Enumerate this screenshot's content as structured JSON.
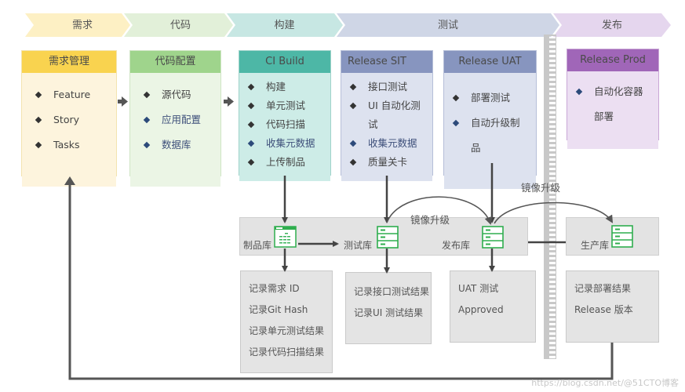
{
  "stages": [
    {
      "label": "需求",
      "color": "#fdf0c4"
    },
    {
      "label": "代码",
      "color": "#e2f0d9"
    },
    {
      "label": "构建",
      "color": "#c7e7e3"
    },
    {
      "label": "测试",
      "color": "#cfd6e6"
    },
    {
      "label": "发布",
      "color": "#e5d6ee"
    }
  ],
  "cards": {
    "requirements": {
      "title": "需求管理",
      "head_color": "#f9d34f",
      "body_color": "#fdf4dd",
      "items": [
        "Feature",
        "Story",
        "Tasks"
      ]
    },
    "code": {
      "title": "代码配置",
      "head_color": "#9fd48c",
      "body_color": "#ebf5e5",
      "items": [
        "源代码",
        "应用配置",
        "数据库"
      ]
    },
    "ci_build": {
      "title": "CI Build",
      "head_color": "#4db7a6",
      "body_color": "#cdece7",
      "items": [
        "构建",
        "单元测试",
        "代码扫描",
        "收集元数据",
        "上传制品"
      ]
    },
    "release_sit": {
      "title": "Release SIT",
      "head_color": "#8795bf",
      "body_color": "#dde2ef",
      "items": [
        "接口测试",
        "UI 自动化测",
        "试",
        "收集元数据",
        "质量关卡"
      ]
    },
    "release_uat": {
      "title": "Release UAT",
      "head_color": "#8795bf",
      "body_color": "#dde2ef",
      "items": [
        "部署测试",
        "自动升级制",
        "品"
      ]
    },
    "release_prod": {
      "title": "Release Prod",
      "head_color": "#a066b8",
      "body_color": "#ecdff2",
      "items": [
        "自动化容器",
        "部署"
      ]
    }
  },
  "repositories": {
    "artifact": "制品库",
    "test": "测试库",
    "release": "发布库",
    "production": "生产库"
  },
  "upgrade_labels": [
    "镜像升级",
    "镜像升级"
  ],
  "notes": {
    "artifact": [
      "记录需求 ID",
      "记录Git Hash",
      "记录单元测试结果",
      "记录代码扫描结果"
    ],
    "test": [
      "记录接口测试结果",
      "记录UI 测试结果"
    ],
    "release": [
      "UAT 测试",
      "Approved"
    ],
    "production": [
      "记录部署结果",
      "Release 版本"
    ]
  },
  "icons": {
    "artifact_store": "folder-table-icon",
    "server": "server-stack-icon",
    "bullet": "diamond-bullet-icon"
  },
  "watermark": "https://blog.csdn.net/@51CTO博客"
}
